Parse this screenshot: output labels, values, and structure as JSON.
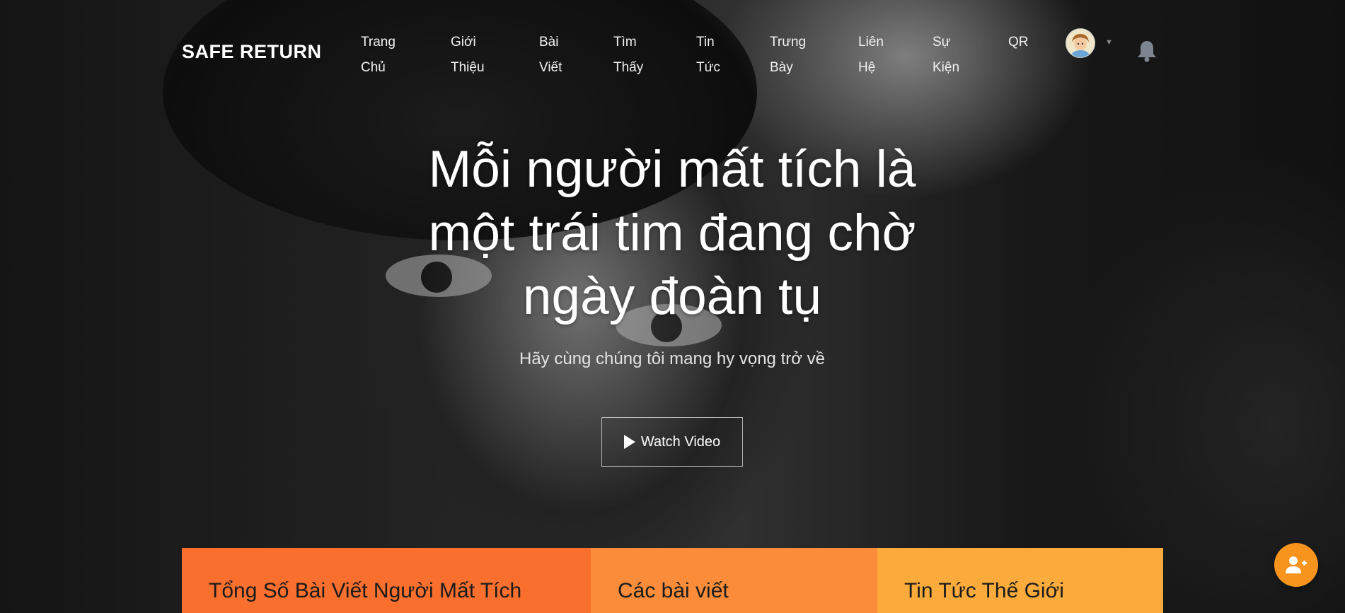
{
  "header": {
    "brand": "SAFE RETURN",
    "nav": [
      {
        "line1": "Trang",
        "line2": "Chủ"
      },
      {
        "line1": "Giới",
        "line2": "Thiệu"
      },
      {
        "line1": "Bài",
        "line2": "Viết"
      },
      {
        "line1": "Tìm",
        "line2": "Thấy"
      },
      {
        "line1": "Tin",
        "line2": "Tức"
      },
      {
        "line1": "Trưng",
        "line2": "Bày"
      },
      {
        "line1": "Liên",
        "line2": "Hệ"
      },
      {
        "line1": "Sự",
        "line2": "Kiện"
      },
      {
        "line1": "QR",
        "line2": ""
      }
    ],
    "icons": {
      "avatar": "user-avatar",
      "caret": "chevron-down-icon",
      "notifications": "bell-icon"
    }
  },
  "hero": {
    "headline_lines": [
      "Mỗi người mất tích là",
      "một trái tim đang chờ",
      "ngày đoàn tụ"
    ],
    "subhead": "Hãy cùng chúng tôi mang hy vọng trở về",
    "cta_label": "Watch Video",
    "cta_icon": "play-icon"
  },
  "stats": [
    {
      "title": "Tổng Số Bài Viết Người Mất Tích",
      "color": "#f86f2e"
    },
    {
      "title": "Các bài viết",
      "color": "#fa8c3a"
    },
    {
      "title": "Tin Tức Thế Giới",
      "color": "#fbab3b"
    }
  ],
  "fab": {
    "icon": "add-user-icon",
    "color": "#f7941d"
  }
}
